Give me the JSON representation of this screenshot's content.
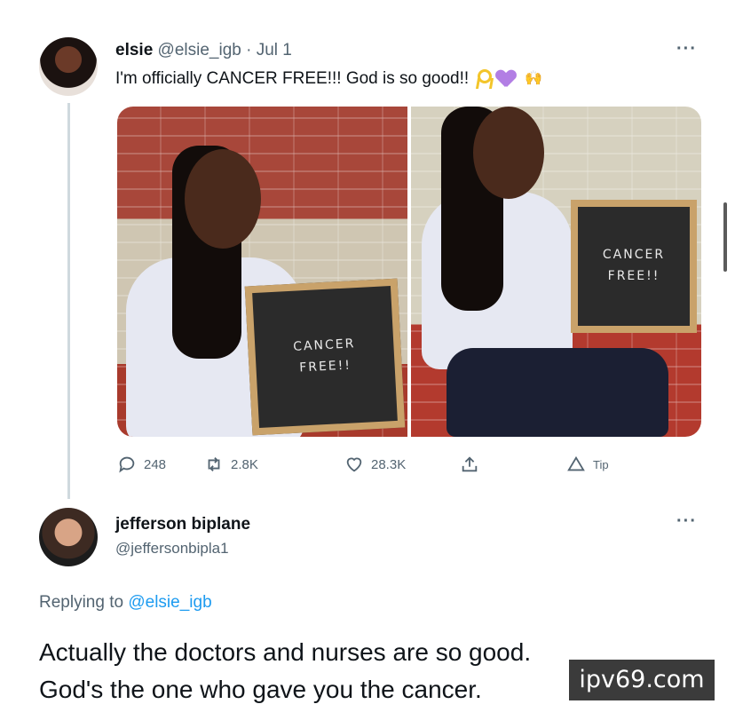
{
  "tweet": {
    "name": "elsie",
    "handle": "@elsie_igb",
    "separator": "·",
    "date": "Jul 1",
    "text": "I'm officially CANCER FREE!!! God is so good!!",
    "emojis": [
      "ribbon-icon",
      "purple-heart-icon",
      "raised-hands-icon"
    ],
    "photos": [
      {
        "sign_line1": "CANCER",
        "sign_line2": "FREE!!"
      },
      {
        "sign_line1": "CANCER",
        "sign_line2": "FREE!!"
      }
    ],
    "actions": {
      "replies": "248",
      "retweets": "2.8K",
      "likes": "28.3K",
      "tip": "Tip"
    }
  },
  "reply": {
    "name": "jefferson biplane",
    "handle": "@jeffersonbipla1",
    "replying_prefix": "Replying to",
    "replying_to": "@elsie_igb",
    "line1": "Actually the doctors and nurses are so good.",
    "line2": "God's the one who gave you the cancer."
  },
  "watermark": "ipv69.com",
  "colors": {
    "link": "#1d9bf0",
    "muted": "#536471",
    "heart": "#b27ee4",
    "ribbon": "#f3c52a"
  }
}
